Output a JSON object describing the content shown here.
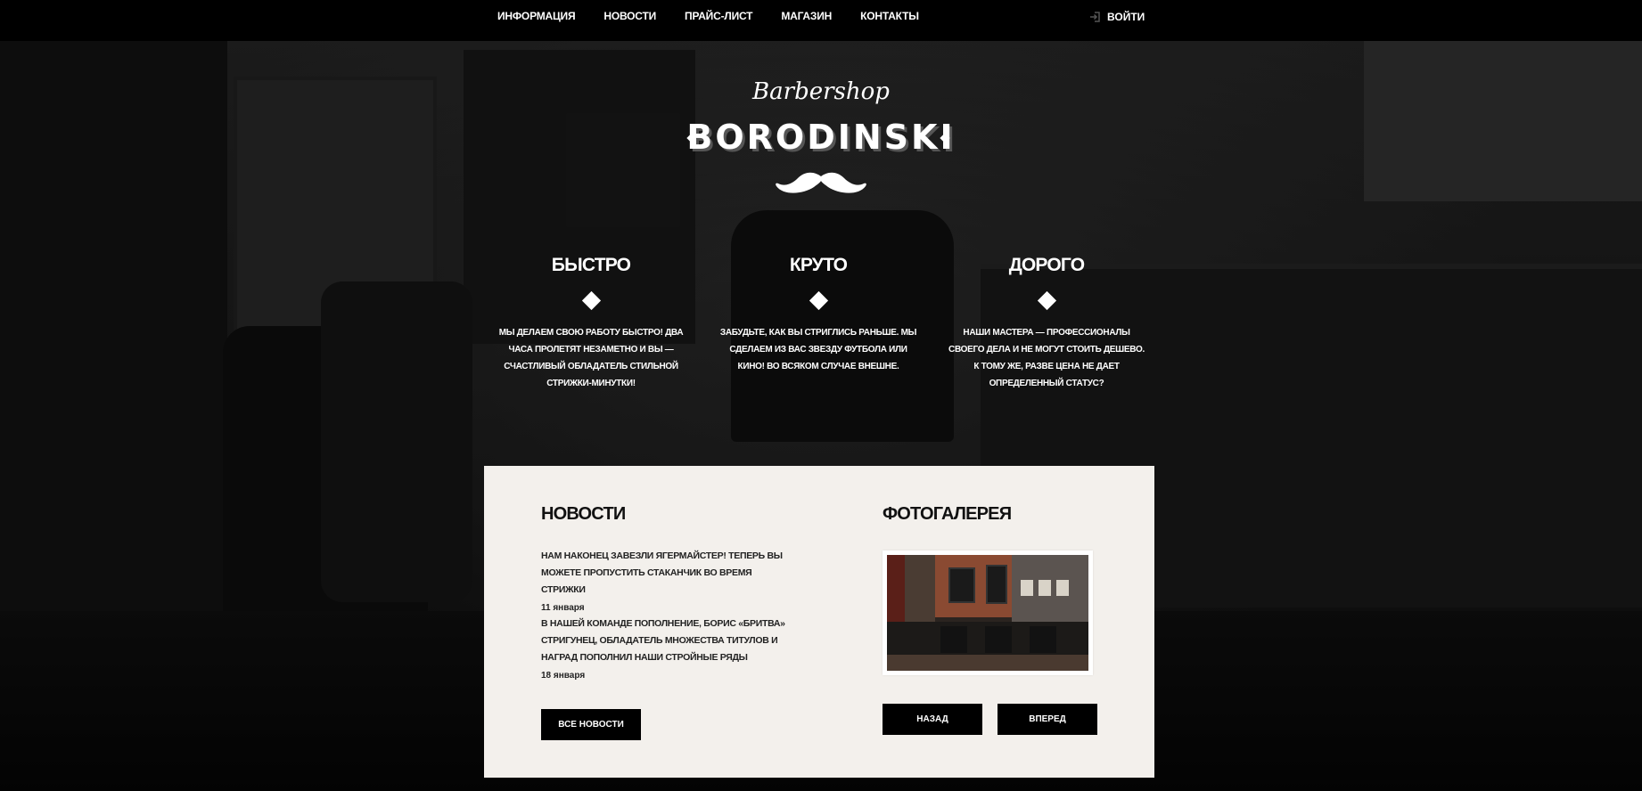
{
  "nav": {
    "items": [
      "ИНФОРМАЦИЯ",
      "НОВОСТИ",
      "ПРАЙС-ЛИСТ",
      "МАГАЗИН",
      "КОНТАКТЫ"
    ],
    "login_label": "ВОЙТИ"
  },
  "logo": {
    "script": "Barbershop",
    "name": "BORODINSKI"
  },
  "features": [
    {
      "title": "БЫСТРО",
      "text": "МЫ ДЕЛАЕМ СВОЮ РАБОТУ БЫСТРО! ДВА ЧАСА ПРОЛЕТЯТ НЕЗАМЕТНО И ВЫ — СЧАСТЛИВЫЙ ОБЛАДАТЕЛЬ СТИЛЬНОЙ СТРИЖКИ-МИНУТКИ!"
    },
    {
      "title": "КРУТО",
      "text": "ЗАБУДЬТЕ, КАК ВЫ СТРИГЛИСЬ РАНЬШЕ. МЫ СДЕЛАЕМ ИЗ ВАС ЗВЕЗДУ ФУТБОЛА ИЛИ КИНО! ВО ВСЯКОМ СЛУЧАЕ ВНЕШНЕ."
    },
    {
      "title": "ДОРОГО",
      "text": "НАШИ МАСТЕРА — ПРОФЕССИОНАЛЫ СВОЕГО ДЕЛА И НЕ МОГУТ СТОИТЬ ДЕШЕВО. К ТОМУ ЖЕ, РАЗВЕ ЦЕНА НЕ ДАЕТ ОПРЕДЕЛЕННЫЙ СТАТУС?"
    }
  ],
  "news": {
    "title": "НОВОСТИ",
    "items": [
      {
        "text": "НАМ НАКОНЕЦ ЗАВЕЗЛИ ЯГЕРМАЙСТЕР! ТЕПЕРЬ ВЫ МОЖЕТЕ ПРОПУСТИТЬ СТАКАНЧИК ВО ВРЕМЯ СТРИЖКИ",
        "date": "11 января"
      },
      {
        "text": "В НАШЕЙ КОМАНДЕ ПОПОЛНЕНИЕ, БОРИС «БРИТВА» СТРИГУНЕЦ, ОБЛАДАТЕЛЬ МНОЖЕСТВА ТИТУЛОВ И НАГРАД ПОПОЛНИЛ НАШИ СТРОЙНЫЕ РЯДЫ",
        "date": "18 января"
      }
    ],
    "all_button": "ВСЕ НОВОСТИ"
  },
  "gallery": {
    "title": "ФОТОГАЛЕРЕЯ",
    "prev_button": "НАЗАД",
    "next_button": "ВПЕРЕД"
  }
}
